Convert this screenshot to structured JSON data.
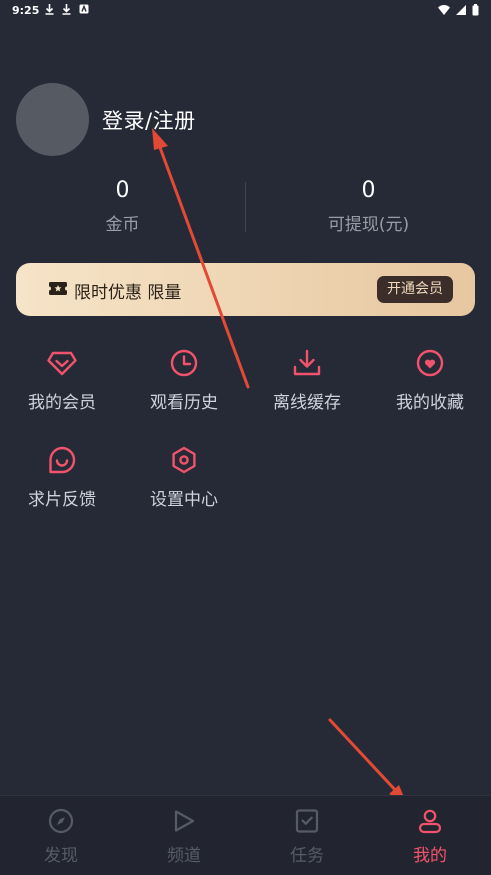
{
  "status_bar": {
    "time": "9:25"
  },
  "profile": {
    "login_label": "登录/注册"
  },
  "stats": [
    {
      "value": "0",
      "label": "金币"
    },
    {
      "value": "0",
      "label": "可提现(元)"
    }
  ],
  "vip_banner": {
    "text": "限时优惠 限量",
    "button_label": "开通会员"
  },
  "grid": [
    {
      "label": "我的会员",
      "icon": "diamond-icon"
    },
    {
      "label": "观看历史",
      "icon": "clock-icon"
    },
    {
      "label": "离线缓存",
      "icon": "download-icon"
    },
    {
      "label": "我的收藏",
      "icon": "heart-icon"
    },
    {
      "label": "求片反馈",
      "icon": "smile-chat-icon"
    },
    {
      "label": "设置中心",
      "icon": "settings-icon"
    }
  ],
  "tabs": [
    {
      "label": "发现",
      "icon": "compass-icon"
    },
    {
      "label": "频道",
      "icon": "play-icon"
    },
    {
      "label": "任务",
      "icon": "task-check-icon"
    },
    {
      "label": "我的",
      "icon": "user-icon",
      "active": true
    }
  ],
  "colors": {
    "background": "#262a36",
    "accent": "#f2536c",
    "vip_gold": "#f6e4c8",
    "annotation_arrow": "#e24a35"
  }
}
